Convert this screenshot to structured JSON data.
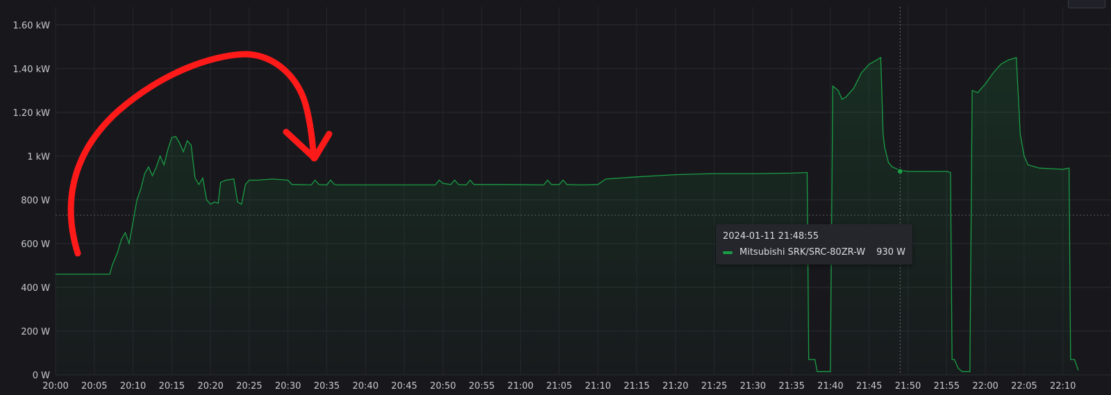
{
  "chart_data": {
    "type": "area",
    "x_tick_labels": [
      "20:00",
      "20:05",
      "20:10",
      "20:15",
      "20:20",
      "20:25",
      "20:30",
      "20:35",
      "20:40",
      "20:45",
      "20:50",
      "20:55",
      "21:00",
      "21:05",
      "21:10",
      "21:15",
      "21:20",
      "21:25",
      "21:30",
      "21:35",
      "21:40",
      "21:45",
      "21:50",
      "21:55",
      "22:00",
      "22:05",
      "22:10"
    ],
    "y_tick_labels": [
      "0 W",
      "200 W",
      "400 W",
      "600 W",
      "800 W",
      "1 kW",
      "1.20 kW",
      "1.40 kW",
      "1.60 kW"
    ],
    "ylim": [
      0,
      1650
    ],
    "xlim_minutes": [
      0,
      132
    ],
    "grid": true,
    "threshold_line_w": 730,
    "series": [
      {
        "name": "Mitsubishi SRK/SRC-80ZR-W",
        "color": "#1a9e45",
        "points": [
          [
            0,
            460
          ],
          [
            7,
            460
          ],
          [
            7.3,
            500
          ],
          [
            8,
            560
          ],
          [
            8.5,
            620
          ],
          [
            9,
            650
          ],
          [
            9.5,
            600
          ],
          [
            10,
            700
          ],
          [
            10.5,
            800
          ],
          [
            11,
            850
          ],
          [
            11.5,
            920
          ],
          [
            12,
            950
          ],
          [
            12.5,
            910
          ],
          [
            13,
            950
          ],
          [
            13.5,
            1000
          ],
          [
            14,
            960
          ],
          [
            14.5,
            1030
          ],
          [
            15,
            1085
          ],
          [
            15.5,
            1090
          ],
          [
            16,
            1060
          ],
          [
            16.5,
            1020
          ],
          [
            17,
            1070
          ],
          [
            17.5,
            1050
          ],
          [
            18,
            900
          ],
          [
            18.5,
            870
          ],
          [
            19,
            900
          ],
          [
            19.5,
            800
          ],
          [
            20,
            780
          ],
          [
            20.5,
            790
          ],
          [
            21,
            785
          ],
          [
            21.3,
            880
          ],
          [
            22,
            890
          ],
          [
            23,
            895
          ],
          [
            23.5,
            790
          ],
          [
            24,
            780
          ],
          [
            24.5,
            870
          ],
          [
            25,
            890
          ],
          [
            26,
            890
          ],
          [
            28,
            895
          ],
          [
            30,
            890
          ],
          [
            30.5,
            870
          ],
          [
            31,
            870
          ],
          [
            33,
            868
          ],
          [
            33.5,
            890
          ],
          [
            34,
            870
          ],
          [
            35,
            868
          ],
          [
            35.5,
            890
          ],
          [
            36,
            870
          ],
          [
            36.5,
            868
          ],
          [
            40,
            868
          ],
          [
            45,
            868
          ],
          [
            49,
            868
          ],
          [
            49.5,
            890
          ],
          [
            50,
            875
          ],
          [
            51,
            870
          ],
          [
            51.5,
            890
          ],
          [
            52,
            870
          ],
          [
            53,
            868
          ],
          [
            53.5,
            890
          ],
          [
            54,
            870
          ],
          [
            58,
            870
          ],
          [
            63,
            868
          ],
          [
            63.5,
            890
          ],
          [
            64,
            870
          ],
          [
            65,
            870
          ],
          [
            65.5,
            890
          ],
          [
            66,
            870
          ],
          [
            68,
            868
          ],
          [
            70,
            870
          ],
          [
            71,
            895
          ],
          [
            75,
            905
          ],
          [
            80,
            915
          ],
          [
            85,
            920
          ],
          [
            90,
            920
          ],
          [
            95,
            922
          ],
          [
            97,
            925
          ],
          [
            97.2,
            70
          ],
          [
            98,
            70
          ],
          [
            98.3,
            15
          ],
          [
            100,
            15
          ],
          [
            100.3,
            1320
          ],
          [
            101,
            1300
          ],
          [
            101.5,
            1260
          ],
          [
            102,
            1270
          ],
          [
            103,
            1310
          ],
          [
            104,
            1380
          ],
          [
            105,
            1420
          ],
          [
            106,
            1440
          ],
          [
            106.5,
            1450
          ],
          [
            106.8,
            1100
          ],
          [
            107,
            1040
          ],
          [
            107.5,
            970
          ],
          [
            108,
            950
          ],
          [
            109,
            935
          ],
          [
            110,
            930
          ],
          [
            115,
            930
          ],
          [
            115.5,
            925
          ],
          [
            115.7,
            70
          ],
          [
            116,
            70
          ],
          [
            116.5,
            30
          ],
          [
            117,
            15
          ],
          [
            118,
            15
          ],
          [
            118.3,
            1300
          ],
          [
            119,
            1290
          ],
          [
            120,
            1330
          ],
          [
            121,
            1380
          ],
          [
            122,
            1420
          ],
          [
            123,
            1440
          ],
          [
            124,
            1450
          ],
          [
            124.5,
            1100
          ],
          [
            125,
            1000
          ],
          [
            125.5,
            960
          ],
          [
            127,
            945
          ],
          [
            130,
            940
          ],
          [
            130.8,
            945
          ],
          [
            131,
            70
          ],
          [
            131.5,
            70
          ],
          [
            132,
            20
          ]
        ]
      }
    ],
    "hover_time_minutes": 109,
    "tooltip": {
      "time": "2024-01-11 21:48:55",
      "series_name": "Mitsubishi SRK/SRC-80ZR-W",
      "value": "930 W"
    },
    "annotation_arrow_color": "#ff1a1a"
  }
}
